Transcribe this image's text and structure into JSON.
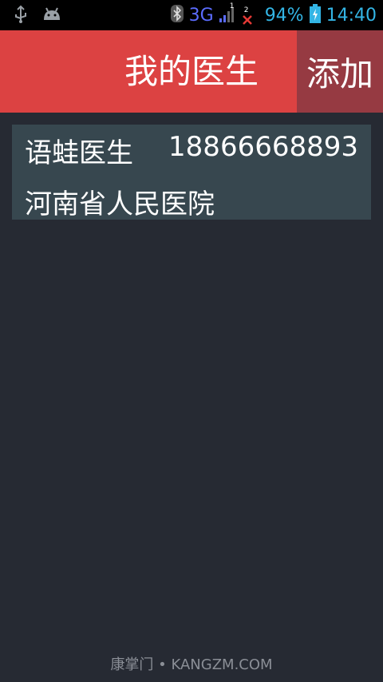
{
  "status_bar": {
    "network": "3G",
    "sim_badge_1": "1",
    "sim_badge_2": "2",
    "battery": "94%",
    "time": "14:40"
  },
  "header": {
    "title": "我的医生",
    "add_label": "添加"
  },
  "doctors": [
    {
      "name": "语蛙医生",
      "phone": "18866668893",
      "hospital": "河南省人民医院"
    }
  ],
  "footer": {
    "watermark": "康掌门 • KANGZM.COM"
  },
  "colors": {
    "header_bg": "#dc4242",
    "add_button_bg": "#963a42",
    "card_bg": "#37474f",
    "page_bg": "#262a33"
  }
}
